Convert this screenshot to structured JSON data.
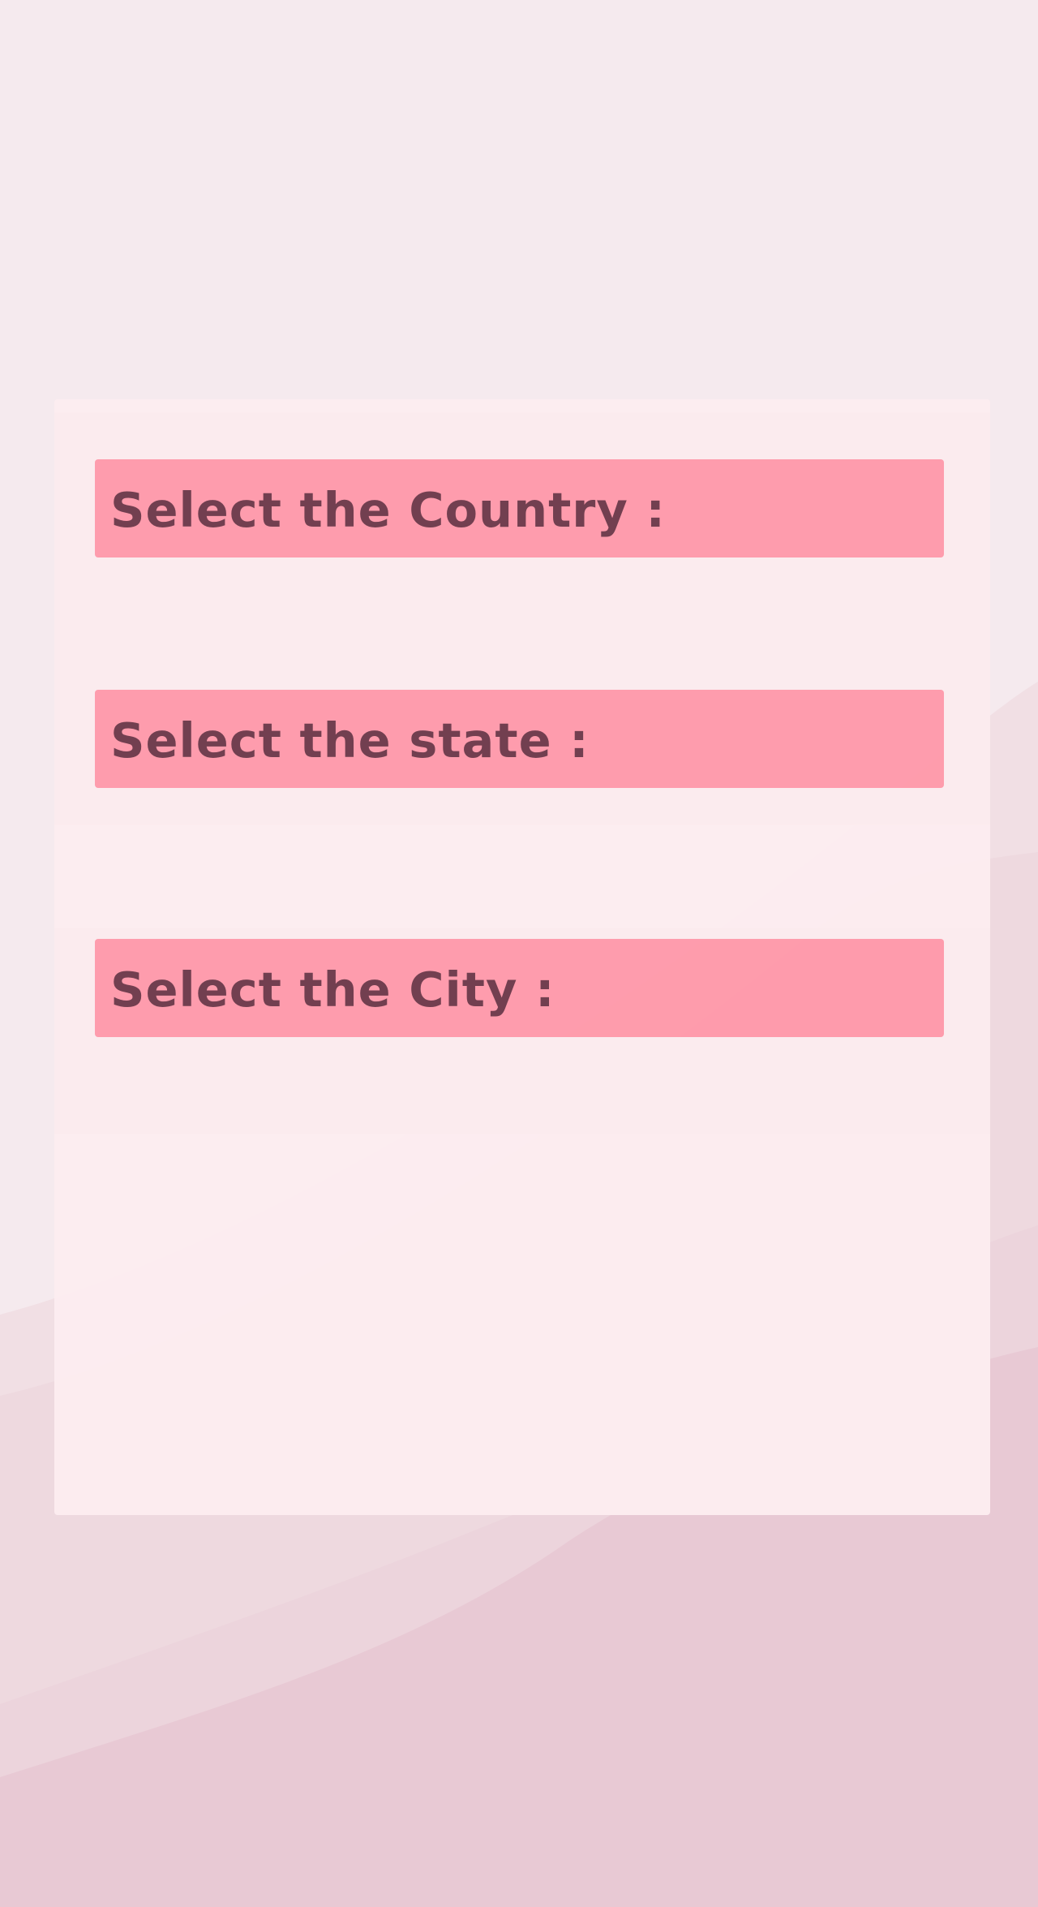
{
  "colors": {
    "page_background": "#f5eaee",
    "card_background": "#fcecef",
    "label_bar": "#ff9aab",
    "label_text": "#6e3a4b",
    "wave_light": "#f1dfe4",
    "wave_mid": "#ecd5dc",
    "wave_dark": "#e7c8d3"
  },
  "form": {
    "country_label": "Select the Country :",
    "state_label": "Select the state :",
    "city_label": "Select the City :"
  }
}
